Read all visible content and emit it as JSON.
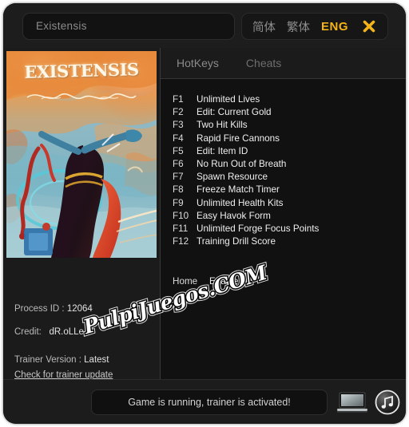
{
  "window": {
    "game_title": "Existensis"
  },
  "header": {
    "languages": [
      {
        "label": "简体",
        "active": false,
        "name": "lang-simplified-chinese"
      },
      {
        "label": "繁体",
        "active": false,
        "name": "lang-traditional-chinese"
      },
      {
        "label": "ENG",
        "active": true,
        "name": "lang-english"
      }
    ],
    "close_icon": "close-icon",
    "accent_color": "#f5b317"
  },
  "cover": {
    "title": "EXISTENSIS",
    "alt": "game-cover-art"
  },
  "tabs": [
    {
      "label": "HotKeys",
      "active": true
    },
    {
      "label": "Cheats",
      "active": false
    }
  ],
  "hotkeys": [
    {
      "key": "F1",
      "desc": "Unlimited Lives"
    },
    {
      "key": "F2",
      "desc": "Edit: Current Gold"
    },
    {
      "key": "F3",
      "desc": "Two Hit Kills"
    },
    {
      "key": "F4",
      "desc": "Rapid Fire Cannons"
    },
    {
      "key": "F5",
      "desc": "Edit: Item ID"
    },
    {
      "key": "F6",
      "desc": "No Run Out of Breath"
    },
    {
      "key": "F7",
      "desc": "Spawn Resource"
    },
    {
      "key": "F8",
      "desc": "Freeze Match Timer"
    },
    {
      "key": "F9",
      "desc": "Unlimited Health Kits"
    },
    {
      "key": "F10",
      "desc": "Easy Havok Form"
    },
    {
      "key": "F11",
      "desc": "Unlimited Forge Focus Points"
    },
    {
      "key": "F12",
      "desc": "Training Drill Score"
    }
  ],
  "enable_all": {
    "key": "Home",
    "label": "Enable All"
  },
  "info": {
    "process_id_label": "Process ID :",
    "process_id_value": "12064",
    "credit_label": "Credit:",
    "credit_value": "dR.oLLe",
    "trainer_version_label": "Trainer Version :",
    "trainer_version_value": "Latest",
    "update_link": "Check for trainer update"
  },
  "footer": {
    "status": "Game is running, trainer is activated!",
    "laptop_icon": "laptop-icon",
    "music_icon": "music-note-icon"
  },
  "watermark": {
    "text": "PulpiJuegos.COM"
  }
}
